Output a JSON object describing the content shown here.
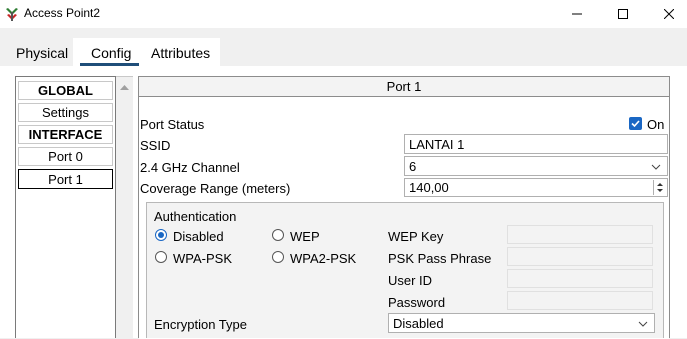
{
  "window": {
    "title": "Access Point2",
    "minimize": "—",
    "maximize": "☐",
    "close": "✕"
  },
  "tabs": [
    {
      "label": "Physical"
    },
    {
      "label": "Config"
    },
    {
      "label": "Attributes"
    }
  ],
  "active_tab": "Config",
  "sidebar": {
    "items": [
      {
        "label": "GLOBAL"
      },
      {
        "label": "Settings"
      },
      {
        "label": "INTERFACE"
      },
      {
        "label": "Port 0"
      },
      {
        "label": "Port 1"
      }
    ],
    "selected": "Port 1"
  },
  "panel": {
    "title": "Port 1",
    "port_status_label": "Port Status",
    "port_status_checked": true,
    "port_status_on_label": "On",
    "ssid_label": "SSID",
    "ssid_value": "LANTAI 1",
    "channel_label": "2.4 GHz Channel",
    "channel_value": "6",
    "coverage_label": "Coverage Range (meters)",
    "coverage_value": "140,00"
  },
  "auth": {
    "title": "Authentication",
    "disabled": "Disabled",
    "wep": "WEP",
    "wpa_psk": "WPA-PSK",
    "wpa2_psk": "WPA2-PSK",
    "selected": "Disabled",
    "wep_key_label": "WEP Key",
    "psk_label": "PSK Pass Phrase",
    "user_id_label": "User ID",
    "password_label": "Password",
    "encryption_label": "Encryption Type",
    "encryption_value": "Disabled"
  },
  "colors": {
    "accent": "#1a67c4",
    "tab_underline": "#1f4e79"
  }
}
